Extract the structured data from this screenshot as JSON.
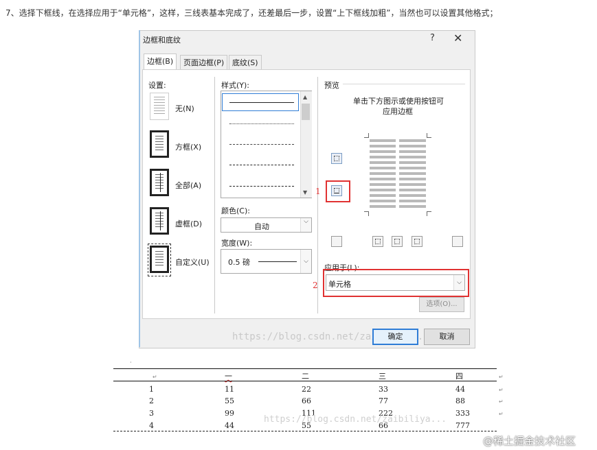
{
  "instruction": "7、选择下框线，在选择应用于“单元格”，这样，三线表基本完成了，还差最后一步，设置“上下框线加粗”，当然也可以设置其他格式；",
  "dialog": {
    "title": "边框和底纹",
    "help": "?",
    "close": "✕",
    "tabs": [
      "边框(B)",
      "页面边框(P)",
      "底纹(S)"
    ],
    "settings_label": "设置:",
    "settings": [
      "无(N)",
      "方框(X)",
      "全部(A)",
      "虚框(D)",
      "自定义(U)"
    ],
    "style_label": "样式(Y):",
    "color_label": "颜色(C):",
    "color_value": "自动",
    "width_label": "宽度(W):",
    "width_value": "0.5 磅",
    "preview_label": "预览",
    "preview_hint_1": "单击下方图示或使用按钮可",
    "preview_hint_2": "应用边框",
    "apply_label": "应用于(L):",
    "apply_value": "单元格",
    "options_button": "选项(O)...",
    "ok_button": "确定",
    "cancel_button": "取消",
    "annotation_1": "1",
    "annotation_2": "2",
    "watermark": "https://blog.csdn.net/zaibiliya..."
  },
  "table": {
    "headers": [
      "一",
      "二",
      "三",
      "四"
    ],
    "rows": [
      {
        "id": "1",
        "values": [
          "11",
          "22",
          "33",
          "44"
        ]
      },
      {
        "id": "2",
        "values": [
          "55",
          "66",
          "77",
          "88"
        ]
      },
      {
        "id": "3",
        "values": [
          "99",
          "111",
          "222",
          "333"
        ]
      },
      {
        "id": "4",
        "values": [
          "44",
          "55",
          "66",
          "777"
        ]
      }
    ],
    "return_mark": "↵",
    "watermark": "https://blog.csdn.net/zaibiliya..."
  },
  "brand": "@稀土掘金技术社区",
  "colors": {
    "annotation_red": "#e03131",
    "focus_blue": "#2e7cd6"
  }
}
